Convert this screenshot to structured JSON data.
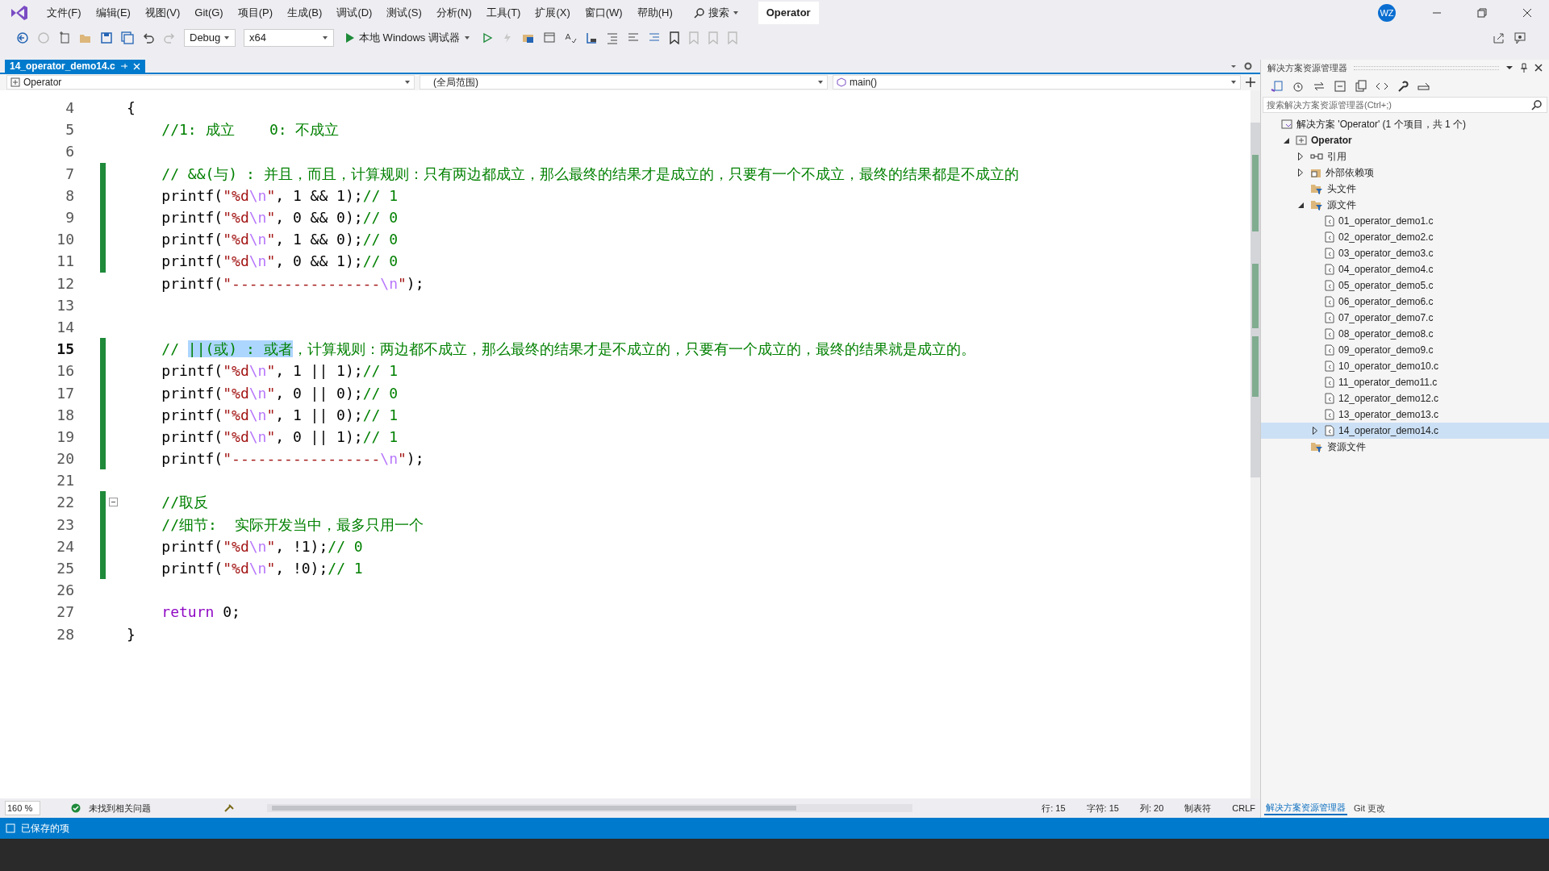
{
  "menu_bar": {
    "items": [
      "文件(F)",
      "编辑(E)",
      "视图(V)",
      "Git(G)",
      "项目(P)",
      "生成(B)",
      "调试(D)",
      "测试(S)",
      "分析(N)",
      "工具(T)",
      "扩展(X)",
      "窗口(W)",
      "帮助(H)"
    ],
    "search": "搜索",
    "solution_title": "Operator",
    "avatar": "WZ"
  },
  "toolbar": {
    "configuration": "Debug",
    "platform": "x64",
    "run_label": "本地 Windows 调试器"
  },
  "editor": {
    "tabs": [
      {
        "label": "14_operator_demo14.c",
        "selected": true
      }
    ],
    "nav": [
      "Operator",
      "(全局范围)",
      "main()"
    ],
    "lines": [
      {
        "number": "4",
        "changed": false,
        "current": false,
        "fold": false,
        "tokens": [
          {
            "kind": "plain",
            "text": "{"
          }
        ]
      },
      {
        "number": "5",
        "changed": false,
        "current": false,
        "fold": false,
        "tokens": [
          {
            "kind": "comment",
            "text": "    //1: 成立    0: 不成立"
          }
        ]
      },
      {
        "number": "6",
        "changed": false,
        "current": false,
        "fold": false
      },
      {
        "number": "7",
        "changed": true,
        "current": false,
        "fold": false,
        "tokens": [
          {
            "kind": "comment",
            "text": "    // &&(与) : 并且，而且，计算规则：只有两边都成立，那么最终的结果才是成立的，只要有一个不成立，最终的结果都是不成立的"
          }
        ]
      },
      {
        "number": "8",
        "changed": true,
        "current": false,
        "fold": false,
        "tokens": [
          {
            "kind": "plain",
            "text": "    printf("
          },
          {
            "kind": "string",
            "text": "\"%d"
          },
          {
            "kind": "escape",
            "text": "\\n"
          },
          {
            "kind": "string",
            "text": "\""
          },
          {
            "kind": "plain",
            "text": ", 1 && 1);"
          },
          {
            "kind": "comment",
            "text": "// 1"
          }
        ]
      },
      {
        "number": "9",
        "changed": true,
        "current": false,
        "fold": false,
        "tokens": [
          {
            "kind": "plain",
            "text": "    printf("
          },
          {
            "kind": "string",
            "text": "\"%d"
          },
          {
            "kind": "escape",
            "text": "\\n"
          },
          {
            "kind": "string",
            "text": "\""
          },
          {
            "kind": "plain",
            "text": ", 0 && 0);"
          },
          {
            "kind": "comment",
            "text": "// 0"
          }
        ]
      },
      {
        "number": "10",
        "changed": true,
        "current": false,
        "fold": false,
        "tokens": [
          {
            "kind": "plain",
            "text": "    printf("
          },
          {
            "kind": "string",
            "text": "\"%d"
          },
          {
            "kind": "escape",
            "text": "\\n"
          },
          {
            "kind": "string",
            "text": "\""
          },
          {
            "kind": "plain",
            "text": ", 1 && 0);"
          },
          {
            "kind": "comment",
            "text": "// 0"
          }
        ]
      },
      {
        "number": "11",
        "changed": true,
        "current": false,
        "fold": false,
        "tokens": [
          {
            "kind": "plain",
            "text": "    printf("
          },
          {
            "kind": "string",
            "text": "\"%d"
          },
          {
            "kind": "escape",
            "text": "\\n"
          },
          {
            "kind": "string",
            "text": "\""
          },
          {
            "kind": "plain",
            "text": ", 0 && 1);"
          },
          {
            "kind": "comment",
            "text": "// 0"
          }
        ]
      },
      {
        "number": "12",
        "changed": false,
        "current": false,
        "fold": false,
        "tokens": [
          {
            "kind": "plain",
            "text": "    printf("
          },
          {
            "kind": "string",
            "text": "\"-----------------"
          },
          {
            "kind": "escape",
            "text": "\\n"
          },
          {
            "kind": "string",
            "text": "\""
          },
          {
            "kind": "plain",
            "text": ");"
          }
        ]
      },
      {
        "number": "13",
        "changed": false,
        "current": false,
        "fold": false
      },
      {
        "number": "14",
        "changed": false,
        "current": false,
        "fold": false
      },
      {
        "number": "15",
        "changed": true,
        "current": true,
        "fold": false,
        "tokens": [
          {
            "kind": "comment",
            "text": "    // "
          },
          {
            "kind": "selected",
            "text": "||(或) : 或者"
          },
          {
            "kind": "comment",
            "text": "，计算规则：两边都不成立，那么最终的结果才是不成立的，只要有一个成立的，最终的结果就是成立的。"
          }
        ]
      },
      {
        "number": "16",
        "changed": true,
        "current": false,
        "fold": false,
        "tokens": [
          {
            "kind": "plain",
            "text": "    printf("
          },
          {
            "kind": "string",
            "text": "\"%d"
          },
          {
            "kind": "escape",
            "text": "\\n"
          },
          {
            "kind": "string",
            "text": "\""
          },
          {
            "kind": "plain",
            "text": ", 1 || 1);"
          },
          {
            "kind": "comment",
            "text": "// 1"
          }
        ]
      },
      {
        "number": "17",
        "changed": true,
        "current": false,
        "fold": false,
        "tokens": [
          {
            "kind": "plain",
            "text": "    printf("
          },
          {
            "kind": "string",
            "text": "\"%d"
          },
          {
            "kind": "escape",
            "text": "\\n"
          },
          {
            "kind": "string",
            "text": "\""
          },
          {
            "kind": "plain",
            "text": ", 0 || 0);"
          },
          {
            "kind": "comment",
            "text": "// 0"
          }
        ]
      },
      {
        "number": "18",
        "changed": true,
        "current": false,
        "fold": false,
        "tokens": [
          {
            "kind": "plain",
            "text": "    printf("
          },
          {
            "kind": "string",
            "text": "\"%d"
          },
          {
            "kind": "escape",
            "text": "\\n"
          },
          {
            "kind": "string",
            "text": "\""
          },
          {
            "kind": "plain",
            "text": ", 1 || 0);"
          },
          {
            "kind": "comment",
            "text": "// 1"
          }
        ]
      },
      {
        "number": "19",
        "changed": true,
        "current": false,
        "fold": false,
        "tokens": [
          {
            "kind": "plain",
            "text": "    printf("
          },
          {
            "kind": "string",
            "text": "\"%d"
          },
          {
            "kind": "escape",
            "text": "\\n"
          },
          {
            "kind": "string",
            "text": "\""
          },
          {
            "kind": "plain",
            "text": ", 0 || 1);"
          },
          {
            "kind": "comment",
            "text": "// 1"
          }
        ]
      },
      {
        "number": "20",
        "changed": true,
        "current": false,
        "fold": false,
        "tokens": [
          {
            "kind": "plain",
            "text": "    printf("
          },
          {
            "kind": "string",
            "text": "\"-----------------"
          },
          {
            "kind": "escape",
            "text": "\\n"
          },
          {
            "kind": "string",
            "text": "\""
          },
          {
            "kind": "plain",
            "text": ");"
          }
        ]
      },
      {
        "number": "21",
        "changed": false,
        "current": false,
        "fold": false
      },
      {
        "number": "22",
        "changed": true,
        "current": false,
        "fold": true,
        "tokens": [
          {
            "kind": "comment",
            "text": "    //取反"
          }
        ]
      },
      {
        "number": "23",
        "changed": true,
        "current": false,
        "fold": false,
        "tokens": [
          {
            "kind": "comment",
            "text": "    //细节:  实际开发当中，最多只用一个"
          }
        ]
      },
      {
        "number": "24",
        "changed": true,
        "current": false,
        "fold": false,
        "tokens": [
          {
            "kind": "plain",
            "text": "    printf("
          },
          {
            "kind": "string",
            "text": "\"%d"
          },
          {
            "kind": "escape",
            "text": "\\n"
          },
          {
            "kind": "string",
            "text": "\""
          },
          {
            "kind": "plain",
            "text": ", !1);"
          },
          {
            "kind": "comment",
            "text": "// 0"
          }
        ]
      },
      {
        "number": "25",
        "changed": true,
        "current": false,
        "fold": false,
        "tokens": [
          {
            "kind": "plain",
            "text": "    printf("
          },
          {
            "kind": "string",
            "text": "\"%d"
          },
          {
            "kind": "escape",
            "text": "\\n"
          },
          {
            "kind": "string",
            "text": "\""
          },
          {
            "kind": "plain",
            "text": ", !0);"
          },
          {
            "kind": "comment",
            "text": "// 1"
          }
        ]
      },
      {
        "number": "26",
        "changed": false,
        "current": false,
        "fold": false
      },
      {
        "number": "27",
        "changed": false,
        "current": false,
        "fold": false,
        "tokens": [
          {
            "kind": "keyword",
            "text": "    return"
          },
          {
            "kind": "plain",
            "text": " 0;"
          }
        ]
      },
      {
        "number": "28",
        "changed": false,
        "current": false,
        "fold": false,
        "tokens": [
          {
            "kind": "plain",
            "text": "}"
          }
        ]
      }
    ],
    "zoom": "160 %",
    "issues": "未找到相关问题",
    "position": [
      "行: 15",
      "字符: 15",
      "列: 20",
      "制表符",
      "CRLF"
    ]
  },
  "solution_explorer": {
    "title": "解决方案资源管理器",
    "search": {
      "placeholder": "搜索解决方案资源管理器(Ctrl+;)"
    },
    "tree": [
      {
        "kind": "solution",
        "label": "解决方案 'Operator' (1 个项目，共 1 个)",
        "selected": false,
        "children": [
          {
            "kind": "project",
            "label": "Operator",
            "expanded": true,
            "selected": false,
            "children": [
              {
                "kind": "references",
                "label": "引用",
                "expanded": false,
                "selected": false
              },
              {
                "kind": "external",
                "label": "外部依赖项",
                "expanded": false,
                "selected": false
              },
              {
                "kind": "filter",
                "label": "头文件",
                "selected": false
              },
              {
                "kind": "filter",
                "label": "源文件",
                "expanded": true,
                "selected": false,
                "children": [
                  {
                    "kind": "file",
                    "label": "01_operator_demo1.c",
                    "selected": false
                  },
                  {
                    "kind": "file",
                    "label": "02_operator_demo2.c",
                    "selected": false
                  },
                  {
                    "kind": "file",
                    "label": "03_operator_demo3.c",
                    "selected": false
                  },
                  {
                    "kind": "file",
                    "label": "04_operator_demo4.c",
                    "selected": false
                  },
                  {
                    "kind": "file",
                    "label": "05_operator_demo5.c",
                    "selected": false
                  },
                  {
                    "kind": "file",
                    "label": "06_operator_demo6.c",
                    "selected": false
                  },
                  {
                    "kind": "file",
                    "label": "07_operator_demo7.c",
                    "selected": false
                  },
                  {
                    "kind": "file",
                    "label": "08_operator_demo8.c",
                    "selected": false
                  },
                  {
                    "kind": "file",
                    "label": "09_operator_demo9.c",
                    "selected": false
                  },
                  {
                    "kind": "file",
                    "label": "10_operator_demo10.c",
                    "selected": false
                  },
                  {
                    "kind": "file",
                    "label": "11_operator_demo11.c",
                    "selected": false
                  },
                  {
                    "kind": "file",
                    "label": "12_operator_demo12.c",
                    "selected": false
                  },
                  {
                    "kind": "file",
                    "label": "13_operator_demo13.c",
                    "selected": false
                  },
                  {
                    "kind": "file",
                    "label": "14_operator_demo14.c",
                    "expanded": false,
                    "selected": true
                  }
                ]
              },
              {
                "kind": "filter",
                "label": "资源文件",
                "selected": false
              }
            ]
          }
        ]
      }
    ],
    "bottom_tabs": [
      {
        "label": "解决方案资源管理器",
        "selected": true
      },
      {
        "label": "Git 更改",
        "selected": false
      }
    ]
  },
  "status_bar": {
    "text": "已保存的项"
  }
}
